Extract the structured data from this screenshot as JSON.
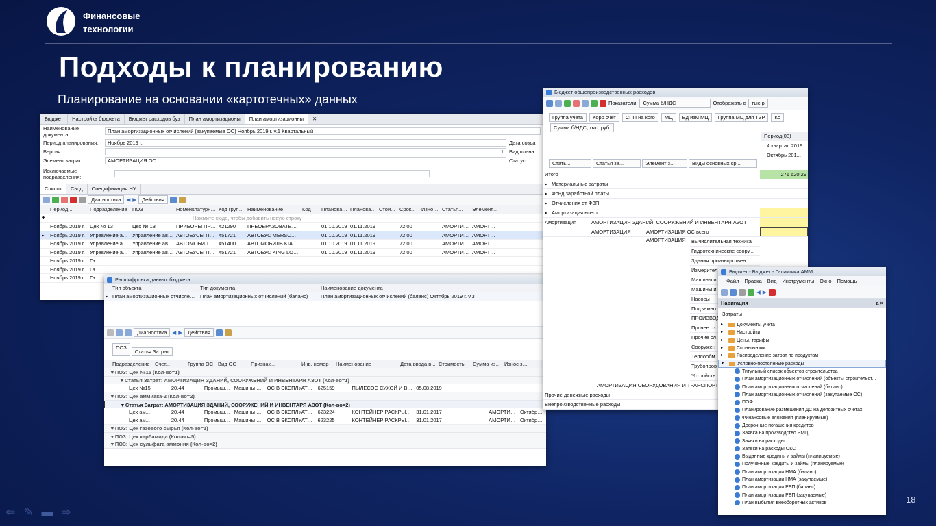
{
  "branding": {
    "line1": "Финансовые",
    "line2": "технологии"
  },
  "slide": {
    "title": "Подходы к планированию",
    "subtitle": "Планирование на основании «картотечных» данных",
    "page": "18"
  },
  "w1": {
    "tabs": [
      "Бюджет",
      "Настройка бюджета",
      "Бюджет расходов буз",
      "План амортизационы",
      "План амортизационны"
    ],
    "doc_label": "Наименование документа:",
    "doc_value": "План амортизационных отчислений (закупаемые ОС) Ноябрь 2019 г. v.1 Квартальный",
    "period_label": "Период планирования:",
    "period_value": "Ноябрь 2019 г.",
    "version_label": "Версия:",
    "version_value": "1",
    "element_label": "Элемент затрат:",
    "element_value": "АМОРТИЗАЦИЯ ОС",
    "excluded_label": "Исключаемые подразделения:",
    "right_labels": [
      "Дата созда",
      "Вид плана:",
      "Статус:"
    ],
    "subtabs": [
      "Список",
      "Свод",
      "Спецификация НУ"
    ],
    "toolbar": {
      "diagnostics": "Диагностика",
      "actions": "Действия"
    },
    "columns": [
      "Период...",
      "Подразделение",
      "ПОЗ",
      "Номенклатурная...",
      "Код группы",
      "Наименование",
      "Код",
      "Плановая...",
      "Плановая...",
      "Стои...",
      "Срок...",
      "Износ...",
      "Статья...",
      "Элемент..."
    ],
    "new_row_hint": "Нажмите сюда, чтобы добавить новую строку",
    "rows": [
      [
        "Ноябрь 2019 г.",
        "Цех № 13",
        "Цех № 13",
        "ПРИБОРЫ ПРО...",
        "421290",
        "ПРЕОБРАЗОВАТЕЛЬ Д...",
        "",
        "01.10.2019",
        "01.11.2019",
        "",
        "72,00",
        "",
        "АМОРТИЗ...",
        "АМОРТИЗ..."
      ],
      [
        "Ноябрь 2019 г.",
        "Управление ав...",
        "Управление автом...",
        "АВТОБУСЫ ПРОЧИЕ",
        "451721",
        "АВТОБУС MERSCEDES...",
        "",
        "01.10.2019",
        "01.11.2019",
        "",
        "72,00",
        "",
        "АМОРТИЗ...",
        "АМОРТИЗ..."
      ],
      [
        "Ноябрь 2019 г.",
        "Управление ав...",
        "Управление автом...",
        "АВТОМОБИЛИ ЛЕ...",
        "451400",
        "АВТОМОБИЛЬ KIA OP...",
        "",
        "01.10.2019",
        "01.11.2019",
        "",
        "72,00",
        "",
        "АМОРТИЗ...",
        "АМОРТИЗ..."
      ],
      [
        "Ноябрь 2019 г.",
        "Управление ав...",
        "Управление автом...",
        "АВТОБУСЫ ПРОЧИЕ",
        "451721",
        "АВТОБУС KING LONG ...",
        "",
        "01.10.2019",
        "01.11.2019",
        "",
        "72,00",
        "",
        "АМОРТИЗ...",
        "АМОРТИЗ..."
      ],
      [
        "Ноябрь 2019 г.",
        "Га",
        "",
        "",
        "",
        "",
        "",
        "",
        "",
        "",
        "",
        "",
        "",
        ""
      ],
      [
        "Ноябрь 2019 г.",
        "Га",
        "",
        "",
        "",
        "",
        "",
        "",
        "",
        "",
        "",
        "",
        "",
        ""
      ],
      [
        "Ноябрь 2019 г.",
        "Га",
        "",
        "",
        "",
        "",
        "",
        "",
        "",
        "",
        "",
        "",
        "",
        ""
      ]
    ]
  },
  "w2": {
    "title": "Расшифровка данных бюджета",
    "top_columns": [
      "Тип объекта",
      "Тип документа",
      "Наименование документа"
    ],
    "top_row": [
      "План амортизационных отчислений (...",
      "План амортизационных отчислений (баланс)",
      "План амортизационных отчислений (баланс) Октябрь 2019 г. v.3"
    ],
    "toolbar": {
      "diagnostics": "Диагностика",
      "actions": "Действия"
    },
    "groupers": [
      "ПОЗ",
      "Статья Затрат"
    ],
    "columns": [
      "Подразделение",
      "Счет...",
      "Группа ОС",
      "Вид ОС",
      "Признак...",
      "Инв. номер",
      "Наименование",
      "Дата ввода в...",
      "Стоимость",
      "Сумма износа",
      "Износ за..."
    ],
    "groups": [
      {
        "text": "ПОЗ: Цех №15 (Кол-во=1)",
        "level": 0
      },
      {
        "text": "Статья Затрат: АМОРТИЗАЦИЯ ЗДАНИЙ, СООРУЖЕНИЙ И ИНВЕНТАРЯ АЗОТ (Кол-во=1)",
        "level": 1
      },
      {
        "row": [
          "Цех №15",
          "20.44",
          "Промышле...",
          "Машины и ...",
          "ОС В ЭКСПЛУАТАЦИИ",
          "625159",
          "ПЫЛЕСОС СУХОЙ И ВЛА...",
          "05.08.2019",
          "",
          "",
          ""
        ]
      },
      {
        "text": "ПОЗ: Цех аммиака-2 (Кол-во=2)",
        "level": 0
      },
      {
        "text": "Статья Затрат: АМОРТИЗАЦИЯ ЗДАНИЙ, СООРУЖЕНИЙ И ИНВЕНТАРЯ АЗОТ (Кол-во=2)",
        "level": 1,
        "selected": true
      },
      {
        "row": [
          "Цех ам...",
          "20.44",
          "Промышле...",
          "Машины и ...",
          "ОС В ЭКСПЛУАТАЦИИ",
          "623224",
          "КОНТЕЙНЕР РАСКРЫВАЮ...",
          "31.01.2017",
          "",
          "АМОРТИЗА...",
          "Октябрь 2..."
        ]
      },
      {
        "row": [
          "Цех ам...",
          "20.44",
          "Промышле...",
          "Машины и ...",
          "ОС В ЭКСПЛУАТАЦИИ",
          "623225",
          "КОНТЕЙНЕР РАСКРЫВАЮ...",
          "31.01.2017",
          "",
          "АМОРТИЗА...",
          "Октябрь 2..."
        ]
      },
      {
        "text": "ПОЗ: Цех газового сырья (Кол-во=1)",
        "level": 0
      },
      {
        "text": "ПОЗ: Цех карбамида (Кол-во=5)",
        "level": 0
      },
      {
        "text": "ПОЗ: Цех сульфата аммония (Кол-во=2)",
        "level": 0
      }
    ]
  },
  "w3": {
    "title": "Бюджет общепроизводственных расходов",
    "indicator_label": "Показатели:",
    "indicator_value": "Сумма б/НДС",
    "display_label": "Отображать в",
    "display_value": "тыс.р",
    "buttons": [
      "Группа учета",
      "Корр счет",
      "СПП на кого",
      "МЦ",
      "Ед изм МЦ",
      "Группа МЦ для ТЗР",
      "Ко"
    ],
    "measure": "Сумма б/НДС, тыс. руб.",
    "period_headers": [
      "Период(03)",
      "4 квартал 2019",
      "Октябрь 201..."
    ],
    "col_headers": [
      "Стать...",
      "Статья за...",
      "Элемент з...",
      "Виды основных ср..."
    ],
    "total_label": "Итого",
    "total_value": "271 620,29",
    "rows": [
      "Материальные затраты",
      "Фонд заработной платы",
      "Отчисления от ФЗП",
      "Амортизация всего"
    ],
    "amort_label": "Амортизация",
    "amort_sub1": "АМОРТИЗАЦИЯ ЗДАНИЙ, СООРУЖЕНИЙ И ИНВЕНТАРЯ АЗОТ",
    "amort_sub2_left": "АМОРТИЗАЦИЯ",
    "amort_sub2": "АМОРТИЗАЦИЯ ОС всего",
    "amort_sub3": "АМОРТИЗАЦИЯ",
    "os_types": [
      "Вычислительная техника",
      "Гидротехнические соору...",
      "Здания производствен...",
      "Измерител",
      "Машины и",
      "Машины и",
      "Насосы",
      "Подъемно",
      "ПРОИЗВОД",
      "Прочее оз",
      "Прочие сл",
      "Сооружен",
      "Теплообм",
      "Трубопров",
      "Устройств"
    ],
    "equip_row": "АМОРТИЗАЦИЯ ОБОРУДОВАНИЯ И ТРАНСПОРТ",
    "bottom_rows": [
      "Прочие денежные расходы",
      "Внепроизводственные расходы"
    ]
  },
  "w4": {
    "title": "Бюджет - Бюджет - Галактика АММ",
    "menu": [
      "Файл",
      "Правка",
      "Вид",
      "Инструменты",
      "Окно",
      "Помощь"
    ],
    "nav_title": "Навигация",
    "nav_pin": "а ×",
    "section": "Затраты",
    "folders": [
      "Документы учета",
      "Настройки",
      "Цены, тарифы",
      "Справочники",
      "Распределение затрат по продуктам",
      "Условно-постоянные расходы"
    ],
    "items": [
      "Титульный список объектов строительства",
      "План амортизационных отчислений (объекты строительст...",
      "План амортизационных отчислений (баланс)",
      "План амортизационных отчислений (закупаемые ОС)",
      "ПОФ",
      "Планирование размещения ДС на депозитных счетах",
      "Финансовые вложения (планируемые)",
      "Досрочные погашения кредитов",
      "Заявка на производство РМЦ",
      "Заявки на расходы",
      "Заявки на расходы ОКС",
      "Выданные кредиты и займы (планируемые)",
      "Полученные кредиты и займы (планируемые)",
      "План амортизации НМА (баланс)",
      "План амортизации НМА (закупаемые)",
      "План амортизации РБП (баланс)",
      "План амортизации РБП (закупаемые)",
      "План выбытия внеоборотных активов"
    ]
  }
}
